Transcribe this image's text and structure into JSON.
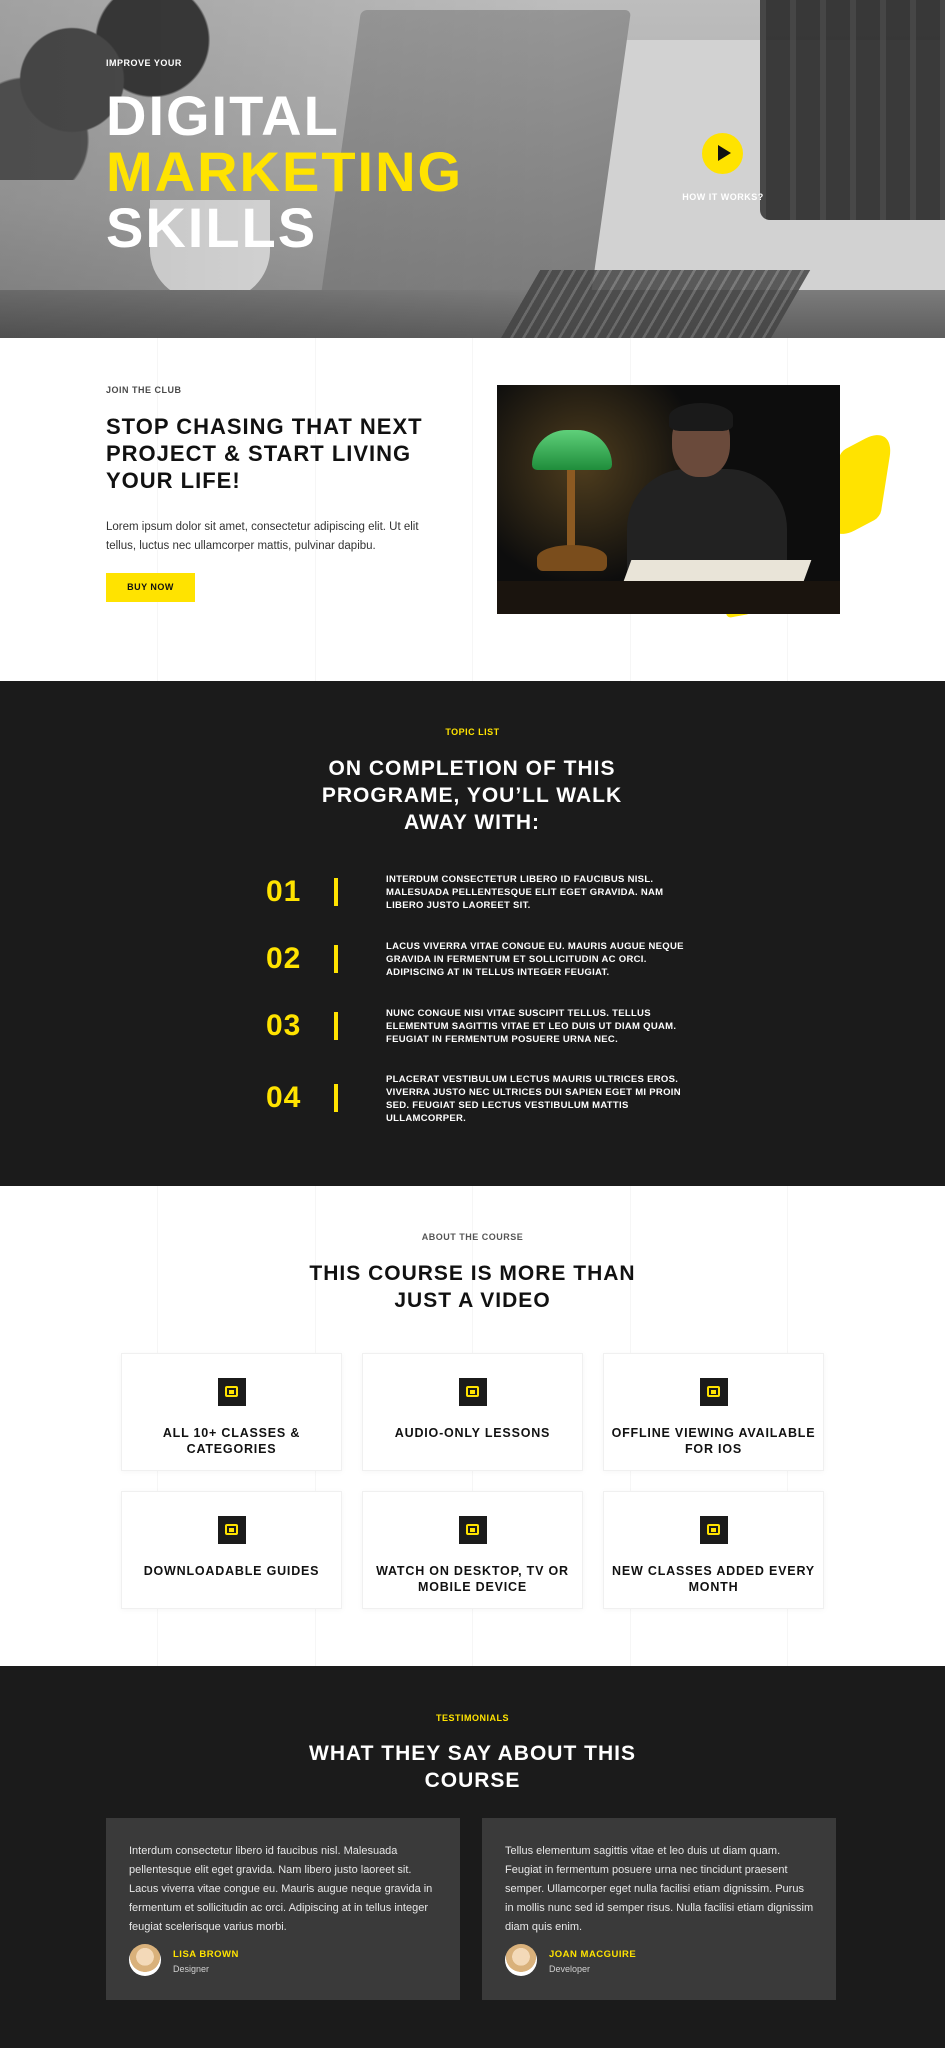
{
  "hero": {
    "eyebrow": "IMPROVE YOUR",
    "title_line1": "DIGITAL",
    "title_line2": "MARKETING",
    "title_line3": "SKILLS",
    "how_label": "HOW IT WORKS?"
  },
  "join": {
    "eyebrow": "JOIN THE CLUB",
    "title": "STOP CHASING THAT NEXT PROJECT & START LIVING YOUR LIFE!",
    "text": "Lorem ipsum dolor sit amet, consectetur adipiscing elit. Ut elit tellus, luctus nec ullamcorper mattis, pulvinar dapibu.",
    "button": "BUY NOW"
  },
  "topics": {
    "eyebrow": "TOPIC LIST",
    "title": "ON COMPLETION OF THIS PROGRAME, YOU’LL WALK AWAY WITH:",
    "items": [
      {
        "num": "01",
        "text": "INTERDUM CONSECTETUR LIBERO ID FAUCIBUS NISL. MALESUADA PELLENTESQUE ELIT EGET GRAVIDA. NAM LIBERO JUSTO LAOREET SIT."
      },
      {
        "num": "02",
        "text": "LACUS VIVERRA VITAE CONGUE EU. MAURIS AUGUE NEQUE GRAVIDA IN FERMENTUM ET SOLLICITUDIN AC ORCI. ADIPISCING AT IN TELLUS INTEGER FEUGIAT."
      },
      {
        "num": "03",
        "text": "NUNC CONGUE NISI VITAE SUSCIPIT TELLUS. TELLUS ELEMENTUM SAGITTIS VITAE ET LEO DUIS UT DIAM QUAM. FEUGIAT IN FERMENTUM POSUERE URNA NEC."
      },
      {
        "num": "04",
        "text": "PLACERAT VESTIBULUM LECTUS MAURIS ULTRICES EROS. VIVERRA JUSTO NEC ULTRICES DUI SAPIEN EGET MI PROIN SED. FEUGIAT SED LECTUS VESTIBULUM MATTIS ULLAMCORPER."
      }
    ]
  },
  "about": {
    "eyebrow": "ABOUT THE COURSE",
    "title": "THIS COURSE IS MORE THAN JUST A VIDEO",
    "features": [
      {
        "label": "ALL 10+ CLASSES & CATEGORIES"
      },
      {
        "label": "AUDIO-ONLY LESSONS"
      },
      {
        "label": "OFFLINE VIEWING AVAILABLE FOR IOS"
      },
      {
        "label": "DOWNLOADABLE GUIDES"
      },
      {
        "label": "WATCH ON DESKTOP, TV OR MOBILE DEVICE"
      },
      {
        "label": "NEW CLASSES ADDED EVERY MONTH"
      }
    ],
    "icon": "photo-icon"
  },
  "testimonials": {
    "eyebrow": "TESTIMONIALS",
    "title": "WHAT THEY SAY ABOUT THIS COURSE",
    "items": [
      {
        "text": "Interdum consectetur libero id faucibus nisl. Malesuada pellentesque elit eget gravida. Nam libero justo laoreet sit. Lacus viverra vitae congue eu. Mauris augue neque gravida in fermentum et sollicitudin ac orci. Adipiscing at in tellus integer feugiat scelerisque varius morbi.",
        "name": "LISA BROWN",
        "role": "Designer"
      },
      {
        "text": "Tellus elementum sagittis vitae et leo duis ut diam quam. Feugiat in fermentum posuere urna nec tincidunt praesent semper. Ullamcorper eget nulla facilisi etiam dignissim. Purus in mollis nunc sed id semper risus. Nulla facilisi etiam dignissim diam quis enim.",
        "name": "JOAN MACGUIRE",
        "role": "Developer"
      }
    ]
  },
  "colors": {
    "accent": "#ffe300",
    "dark": "#1b1b1b",
    "card_dark": "#3a3a3a"
  }
}
